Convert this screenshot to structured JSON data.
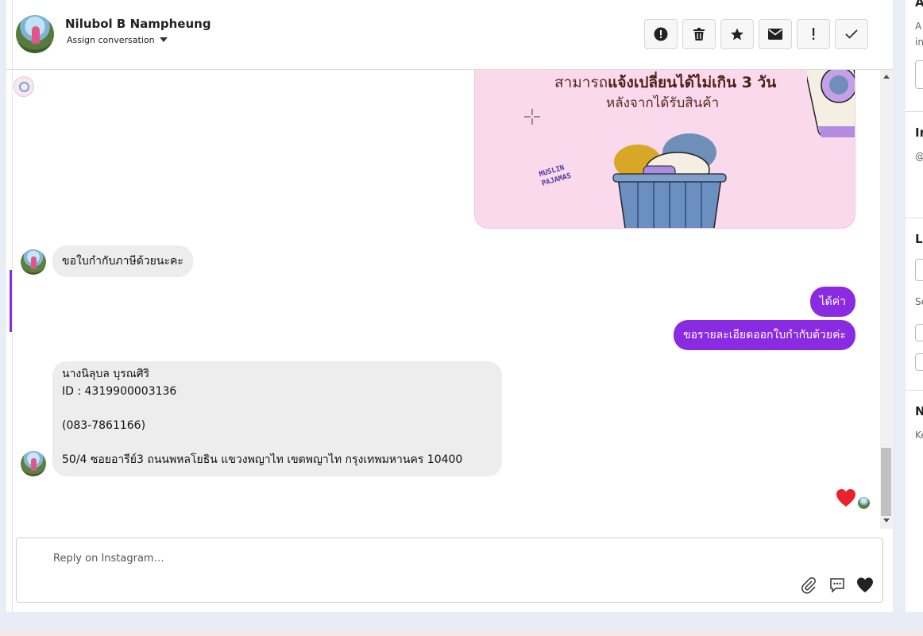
{
  "header": {
    "contact_name": "Nilubol B Nampheung",
    "assign_label": "Assign conversation",
    "actions": [
      "alert-circle-icon",
      "trash-icon",
      "star-icon",
      "envelope-icon",
      "exclamation-icon",
      "check-icon"
    ]
  },
  "image_card": {
    "line1_prefix": "สามารถ",
    "line1_bold": "แจ้งเปลี่ยนได้ไม่เกิน 3 วัน",
    "line2": "หลังจากได้รับสินค้า",
    "brand_text": "MUSLIN\nPAJAMAS"
  },
  "messages": {
    "incoming1": "ขอใบกำกับภาษีด้วยนะคะ",
    "outgoing1": "ได้ค่า",
    "outgoing2": "ขอรายละเอียดออกใบกำกับด้วยค่ะ",
    "incoming2": "นางนิลุบล บุรณศิริ\nID : 4319900003136\n\n(083-7861166)\n\n50/4 ซอยอารีย์3 ถนนพหลโยธิน แขวงพญาไท เขตพญาไท กรุงเทพมหานคร 10400"
  },
  "reply": {
    "placeholder": "Reply on Instagram…",
    "icons": [
      "paperclip-icon",
      "speech-bubble-icon",
      "heart-icon"
    ]
  },
  "sidebar": {
    "section1_title": "A",
    "section1_text1": "A",
    "section1_text2": "in",
    "section2_title": "In",
    "section2_text": "@",
    "section3_title": "L",
    "section3_text": "Se",
    "section4_title": "N",
    "section4_text": "Ke"
  },
  "colors": {
    "accent": "#8a2be2",
    "incoming_bubble": "#ededed",
    "reaction_heart": "#e8232d"
  }
}
